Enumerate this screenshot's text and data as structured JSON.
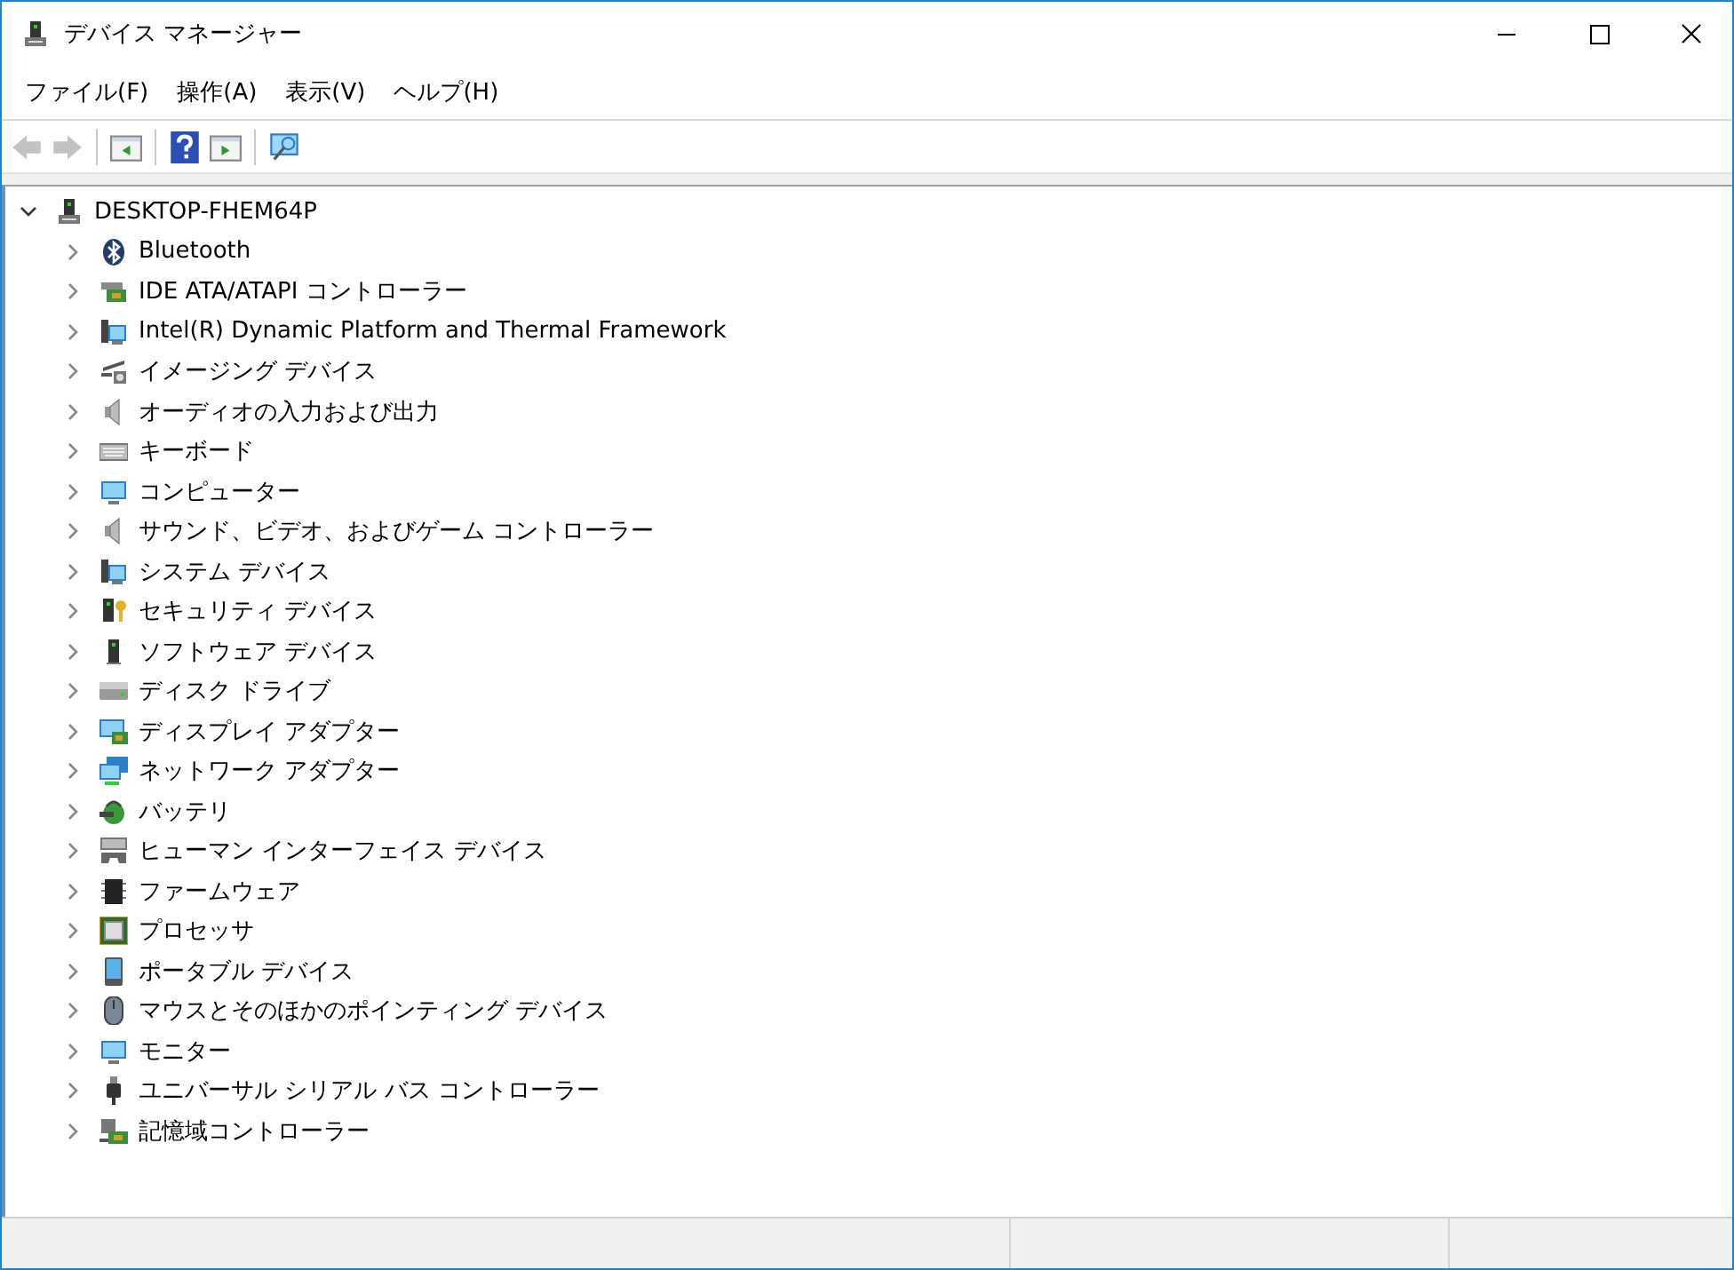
{
  "window": {
    "title": "デバイス マネージャー"
  },
  "menu": [
    "ファイル(F)",
    "操作(A)",
    "表示(V)",
    "ヘルプ(H)"
  ],
  "toolbar": [
    {
      "kind": "back",
      "disabled": true
    },
    {
      "kind": "forward",
      "disabled": true
    },
    {
      "kind": "separator"
    },
    {
      "kind": "pane-left",
      "disabled": false
    },
    {
      "kind": "separator"
    },
    {
      "kind": "help",
      "disabled": false
    },
    {
      "kind": "pane-right",
      "disabled": false
    },
    {
      "kind": "separator"
    },
    {
      "kind": "scan",
      "disabled": false
    }
  ],
  "tree": {
    "label": "DESKTOP-FHEM64P",
    "expanded": true,
    "children": [
      {
        "label": "Bluetooth",
        "expanded": false
      },
      {
        "label": "IDE ATA/ATAPI コントローラー",
        "expanded": false
      },
      {
        "label": "Intel(R) Dynamic Platform and Thermal Framework",
        "expanded": false
      },
      {
        "label": "イメージング デバイス",
        "expanded": false
      },
      {
        "label": "オーディオの入力および出力",
        "expanded": false
      },
      {
        "label": "キーボード",
        "expanded": false
      },
      {
        "label": "コンピューター",
        "expanded": false
      },
      {
        "label": "サウンド、ビデオ、およびゲーム コントローラー",
        "expanded": false
      },
      {
        "label": "システム デバイス",
        "expanded": false
      },
      {
        "label": "セキュリティ デバイス",
        "expanded": false
      },
      {
        "label": "ソフトウェア デバイス",
        "expanded": false
      },
      {
        "label": "ディスク ドライブ",
        "expanded": false
      },
      {
        "label": "ディスプレイ アダプター",
        "expanded": false
      },
      {
        "label": "ネットワーク アダプター",
        "expanded": false
      },
      {
        "label": "バッテリ",
        "expanded": false
      },
      {
        "label": "ヒューマン インターフェイス デバイス",
        "expanded": false
      },
      {
        "label": "ファームウェア",
        "expanded": false
      },
      {
        "label": "プロセッサ",
        "expanded": false
      },
      {
        "label": "ポータブル デバイス",
        "expanded": false
      },
      {
        "label": "マウスとそのほかのポインティング デバイス",
        "expanded": false
      },
      {
        "label": "モニター",
        "expanded": false
      },
      {
        "label": "ユニバーサル シリアル バス コントローラー",
        "expanded": false
      },
      {
        "label": "記憶域コントローラー",
        "expanded": false
      }
    ]
  }
}
